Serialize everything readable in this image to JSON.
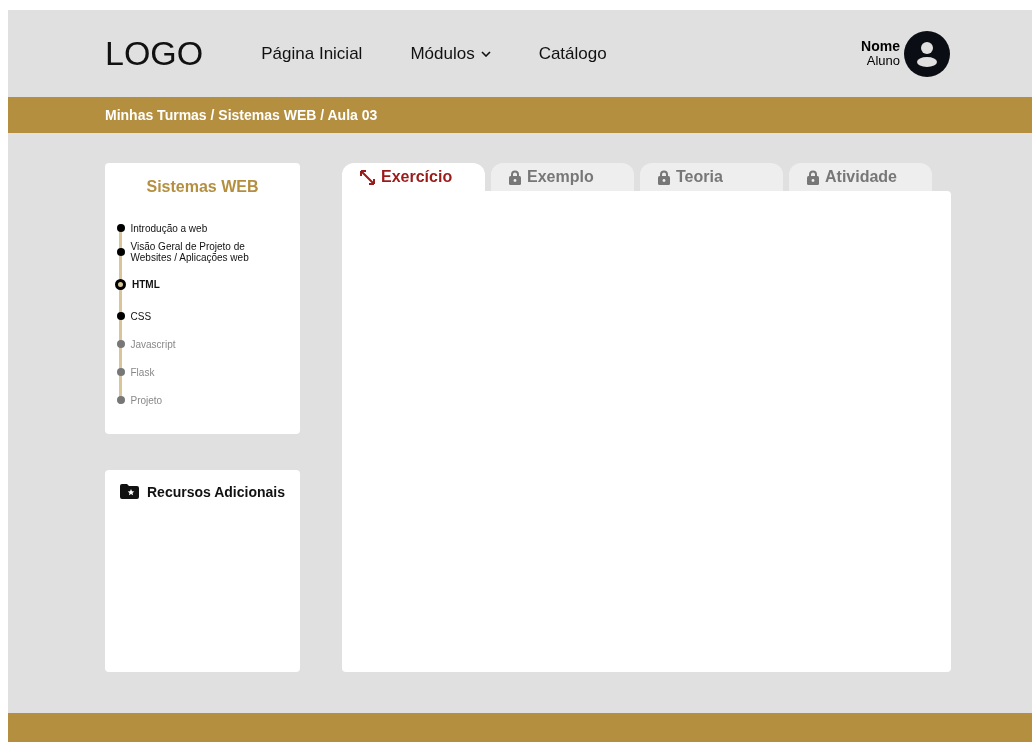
{
  "header": {
    "logo": "LOGO",
    "nav": [
      {
        "label": "Página Inicial",
        "dropdown": false
      },
      {
        "label": "Módulos",
        "dropdown": true
      },
      {
        "label": "Catálogo",
        "dropdown": false
      }
    ],
    "user": {
      "name": "Nome",
      "role": "Aluno"
    }
  },
  "breadcrumb": "Minhas Turmas / Sistemas WEB / Aula 03",
  "course": {
    "title": "Sistemas WEB",
    "lessons": [
      {
        "label": "Introdução a web",
        "current": false,
        "locked": false
      },
      {
        "label": "Visão Geral de Projeto de Websites / Aplicações web",
        "current": false,
        "locked": false
      },
      {
        "label": "HTML",
        "current": true,
        "locked": false
      },
      {
        "label": "CSS",
        "current": false,
        "locked": false
      },
      {
        "label": "Javascript",
        "current": false,
        "locked": true
      },
      {
        "label": "Flask",
        "current": false,
        "locked": true
      },
      {
        "label": "Projeto",
        "current": false,
        "locked": true
      }
    ]
  },
  "resources": {
    "title": "Recursos Adicionais"
  },
  "tabs": [
    {
      "label": "Exercício",
      "selected": true,
      "locked": false
    },
    {
      "label": "Exemplo",
      "selected": false,
      "locked": true
    },
    {
      "label": "Teoria",
      "selected": false,
      "locked": true
    },
    {
      "label": "Atividade",
      "selected": false,
      "locked": true
    }
  ]
}
